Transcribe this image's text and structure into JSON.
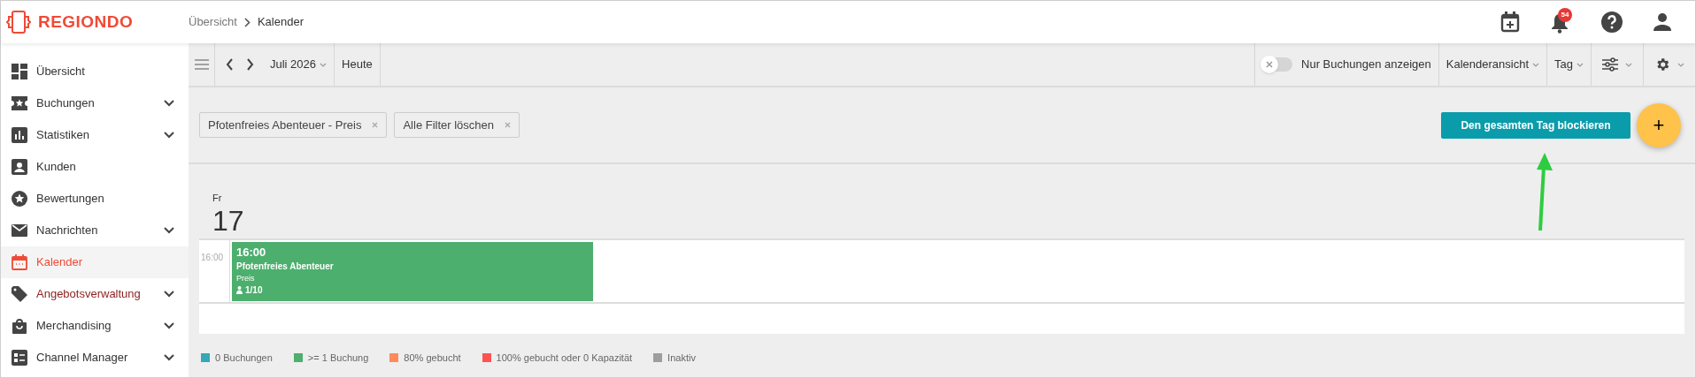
{
  "brand": {
    "name": "REGIONDO"
  },
  "breadcrumb": [
    "Übersicht",
    "Kalender"
  ],
  "header": {
    "notification_count": "54"
  },
  "sidebar": {
    "items": [
      {
        "label": "Übersicht",
        "kind": "dashboard",
        "expandable": false,
        "selected": false,
        "accent": false
      },
      {
        "label": "Buchungen",
        "kind": "ticket",
        "expandable": true,
        "selected": false,
        "accent": false
      },
      {
        "label": "Statistiken",
        "kind": "chart",
        "expandable": true,
        "selected": false,
        "accent": false
      },
      {
        "label": "Kunden",
        "kind": "person",
        "expandable": false,
        "selected": false,
        "accent": false
      },
      {
        "label": "Bewertungen",
        "kind": "star",
        "expandable": false,
        "selected": false,
        "accent": false
      },
      {
        "label": "Nachrichten",
        "kind": "mail",
        "expandable": true,
        "selected": false,
        "accent": false
      },
      {
        "label": "Kalender",
        "kind": "calendar",
        "expandable": false,
        "selected": true,
        "accent": false
      },
      {
        "label": "Angebotsverwaltung",
        "kind": "tag",
        "expandable": true,
        "selected": false,
        "accent": true
      },
      {
        "label": "Merchandising",
        "kind": "bag",
        "expandable": true,
        "selected": false,
        "accent": false
      },
      {
        "label": "Channel Manager",
        "kind": "grid",
        "expandable": true,
        "selected": false,
        "accent": false
      }
    ]
  },
  "toolbar": {
    "month": "Juli 2026",
    "today": "Heute",
    "only_bookings": {
      "label": "Nur Buchungen anzeigen",
      "on": false
    },
    "view": "Kalenderansicht",
    "range": "Tag"
  },
  "filters": [
    {
      "label": "Pfotenfreies Abenteuer - Preis"
    },
    {
      "label": "Alle Filter löschen"
    }
  ],
  "block_button": "Den gesamten Tag blockieren",
  "add_button": "+",
  "day": {
    "weekday": "Fr",
    "date": "17"
  },
  "timeline": {
    "hour": "16:00",
    "events": [
      {
        "time": "16:00",
        "title": "Pfotenfreies Abenteuer",
        "subtitle": "Preis",
        "capacity": "1/10",
        "color": "#4caf6d"
      }
    ]
  },
  "legend": [
    {
      "label": "0 Buchungen",
      "color": "#35a8b8"
    },
    {
      "label": ">= 1 Buchung",
      "color": "#4caf6d"
    },
    {
      "label": "80% gebucht",
      "color": "#ff8a5c"
    },
    {
      "label": "100% gebucht oder 0 Kapazität",
      "color": "#ff5252"
    },
    {
      "label": "Inaktiv",
      "color": "#9e9e9e"
    }
  ]
}
